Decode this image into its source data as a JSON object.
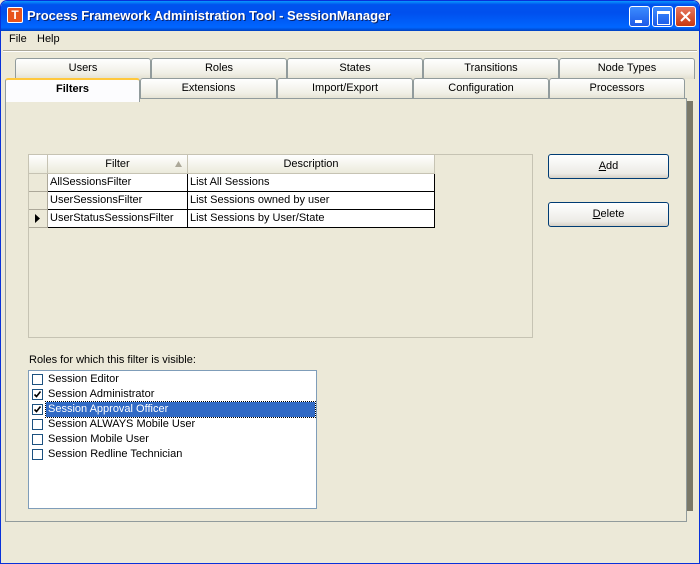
{
  "window": {
    "title": "Process Framework Administration Tool - SessionManager",
    "app_icon_letter": "T"
  },
  "menu": {
    "file": "File",
    "help": "Help"
  },
  "tabs_top": [
    "Users",
    "Roles",
    "States",
    "Transitions",
    "Node Types"
  ],
  "tabs_bottom": [
    "Filters",
    "Extensions",
    "Import/Export",
    "Configuration",
    "Processors"
  ],
  "active_tab": "Filters",
  "grid": {
    "columns": [
      "Filter",
      "Description"
    ],
    "rows": [
      {
        "filter": "AllSessionsFilter",
        "description": "List All Sessions"
      },
      {
        "filter": "UserSessionsFilter",
        "description": "List Sessions owned by user"
      },
      {
        "filter": "UserStatusSessionsFilter",
        "description": "List Sessions by User/State"
      }
    ],
    "current_row": 2
  },
  "buttons": {
    "add": {
      "mnemonic": "A",
      "rest": "dd"
    },
    "delete": {
      "mnemonic": "D",
      "rest": "elete"
    }
  },
  "roles": {
    "label": "Roles for which this filter is visible:",
    "items": [
      {
        "label": "Session Editor",
        "checked": false,
        "selected": false
      },
      {
        "label": "Session Administrator",
        "checked": true,
        "selected": false
      },
      {
        "label": "Session Approval Officer",
        "checked": true,
        "selected": true
      },
      {
        "label": "Session ALWAYS Mobile User",
        "checked": false,
        "selected": false
      },
      {
        "label": "Session Mobile User",
        "checked": false,
        "selected": false
      },
      {
        "label": "Session Redline Technician",
        "checked": false,
        "selected": false
      }
    ]
  },
  "colors": {
    "titlebar": "#0053ee",
    "selection": "#316ac5",
    "window_bg": "#ece9d8",
    "active_tab_accent": "#ffc83c"
  }
}
